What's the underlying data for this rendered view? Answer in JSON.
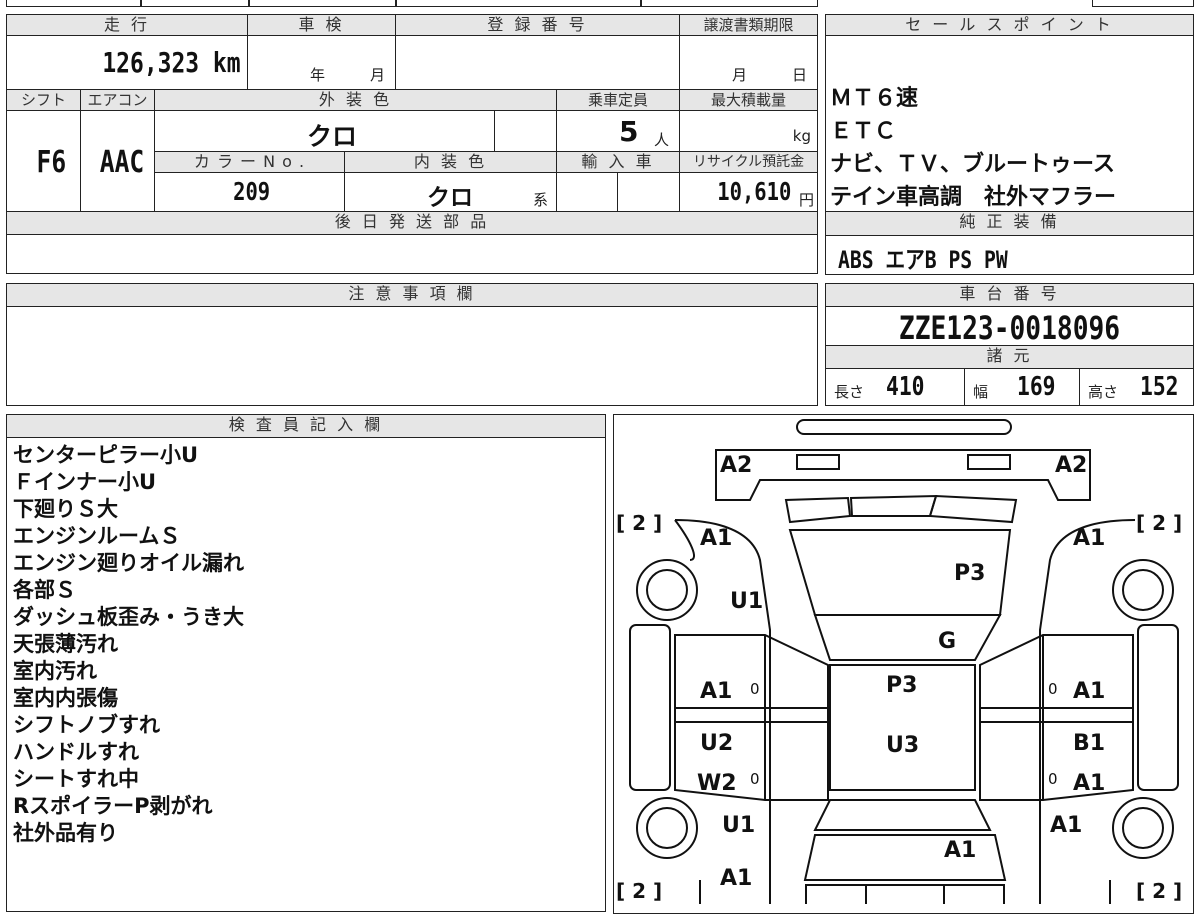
{
  "header": {
    "mileage_label": "走 行",
    "inspection_label": "車 検",
    "registration_label": "登 録 番 号",
    "transfer_label": "譲渡書類期限",
    "shift_label": "シフト",
    "ac_label": "エアコン",
    "exterior_label": "外 装 色",
    "capacity_label": "乗車定員",
    "maxload_label": "最大積載量",
    "color_no_label": "カ ラ ー N o .",
    "interior_label": "内 装 色",
    "import_label": "輸 入 車",
    "recycle_label": "リサイクル預託金",
    "later_parts_label": "後 日 発 送 部 品",
    "notes_label": "注 意 事 項 欄",
    "inspector_label": "検 査 員 記 入 欄"
  },
  "values": {
    "mileage": "126,323 km",
    "year_unit": "年",
    "month_unit": "月",
    "transfer_month": "月",
    "transfer_day": "日",
    "shift": "F6",
    "ac": "AAC",
    "exterior_color": "クロ",
    "capacity": "5",
    "capacity_unit": "人",
    "maxload_unit": "kg",
    "color_no": "209",
    "interior_color": "クロ",
    "interior_suffix": "系",
    "recycle_fee": "10,610",
    "yen": "円"
  },
  "sales_points": {
    "title": "セ ー ル ス ポ イ ン ト",
    "lines": [
      "ＭＴ６速",
      "ＥＴＣ",
      "ナビ、ＴＶ、ブルートゥース",
      "テイン車高調　社外マフラー"
    ]
  },
  "standard_equipment": {
    "title": "純 正 装 備",
    "value": "ABS エアB PS PW"
  },
  "chassis": {
    "title": "車 台 番 号",
    "value": "ZZE123-0018096",
    "spec_title": "諸 元",
    "length_label": "長さ",
    "length": "410",
    "width_label": "幅",
    "width": "169",
    "height_label": "高さ",
    "height": "152"
  },
  "inspector_notes": [
    "センターピラー小U",
    "Ｆインナー小U",
    "下廻りＳ大",
    "エンジンルームＳ",
    "エンジン廻りオイル漏れ",
    "各部Ｓ",
    "ダッシュ板歪み・うき大",
    "天張薄汚れ",
    "室内汚れ",
    "室内内張傷",
    "シフトノブすれ",
    "ハンドルすれ",
    "シートすれ中",
    "RスポイラーP剥がれ",
    "社外品有り"
  ],
  "diagram": {
    "labels": {
      "a2_left": "A2",
      "a2_right": "A2",
      "bracket_tl": "[ 2 ]",
      "bracket_tr": "[ 2 ]",
      "bracket_bl": "[ 2 ]",
      "bracket_br": "[ 2 ]",
      "a1_fl": "A1",
      "a1_fr": "A1",
      "u1_left": "U1",
      "p3_hood": "P3",
      "g_windshield": "G",
      "a1_front_door_l": "A1",
      "zero_fl": "0",
      "a1_front_door_r": "A1",
      "zero_fr": "0",
      "p3_roof": "P3",
      "u2_rear_door_l": "U2",
      "w2_rear_door_l": "W2",
      "zero_rl": "0",
      "u3_roof": "U3",
      "b1_rear_door_r": "B1",
      "zero_rr": "0",
      "a1_rear_door_r": "A1",
      "u1_rear_l": "U1",
      "a1_rear_r": "A1",
      "a1_trunk": "A1",
      "a1_rear_bottom_l": "A1"
    }
  }
}
